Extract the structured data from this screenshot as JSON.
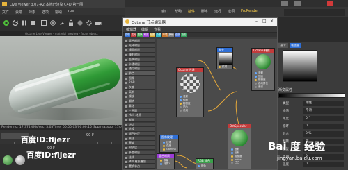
{
  "viewer": {
    "title": "Live Viewer 3.07-R2 本地已渲染 C4D 第一图",
    "menu": [
      "文件",
      "云端",
      "对象",
      "选项",
      "帮助",
      "Gui"
    ],
    "info_text": "Octane Live Viewer - material preview - focus object",
    "status": {
      "rendering": "Rendering: 17.374%",
      "ms": "Ms/sec: 3.03",
      "time": "Time: 00:00:03/00:00:15",
      "spp": "Spp/maxspp: 174/"
    },
    "timeline_value": "90 F",
    "lower_value": "90 F"
  },
  "c4d_menu": [
    {
      "label": "窗口",
      "highlight": false
    },
    {
      "label": "帮助",
      "highlight": false
    },
    {
      "label": "插件",
      "highlight": true
    },
    {
      "label": "脚本",
      "highlight": false
    },
    {
      "label": "运行",
      "highlight": false
    },
    {
      "label": "选项",
      "highlight": false
    },
    {
      "label": "ProRender",
      "highlight": true
    }
  ],
  "node_window": {
    "title": "Octane 节点编辑器",
    "menu": [
      "编辑器",
      "编辑",
      "查看"
    ],
    "tabs": [
      {
        "label": "纹理",
        "color": "#2f6fd6"
      },
      {
        "label": "发光",
        "color": "#c23b3b"
      },
      {
        "label": "置换",
        "color": "#3aa04a"
      },
      {
        "label": "材质",
        "color": "#9b3bd6"
      },
      {
        "label": "贴图",
        "color": "#d6a82f"
      },
      {
        "label": "介质",
        "color": "#2fb8c8"
      },
      {
        "label": "环境",
        "color": "#c8782f"
      },
      {
        "label": "其他",
        "color": "#7b7b7b"
      },
      {
        "label": "全部",
        "color": "#3b6bd6"
      },
      {
        "label": "投影",
        "color": "#2fa05a"
      }
    ],
    "list": [
      "混合材质",
      "光泽材质",
      "镜面材质",
      "漫射材质",
      "金属材质",
      "卡通材质",
      "通用材质",
      "节点",
      "图像",
      "RGB",
      "灰度",
      "高斯",
      "噪波",
      "翻转",
      "雾化",
      "三平面",
      "Hair 材质",
      "渐变",
      "烘焙",
      "转换",
      "颜色校正",
      "乘法",
      "衰减",
      "材质层",
      "多重材质",
      "法线",
      "MIX 材质叠加",
      "置换节点"
    ],
    "nodes": {
      "gradient": {
        "title": "渐变",
        "pins": [
          "纹理"
        ]
      },
      "material": {
        "title": "Octane 材质",
        "pins": [
          "漫射",
          "镜面",
          "粗糙度",
          "各向异性",
          "索引",
          "凹凸",
          "法线",
          "置换",
          "透明度"
        ]
      },
      "glossy": {
        "title": "Octane 光泽",
        "pins": [
          "漫射",
          "镜面",
          "粗糙度",
          "凹凸",
          "法线"
        ]
      },
      "image": {
        "title": "图像纹理",
        "pins": [
          "纹理",
          "强度",
          "Gamma"
        ]
      },
      "specular": {
        "title": "OctSpecular",
        "pins": [
          "透射",
          "反射",
          "粗糙度",
          "Index",
          "凹凸",
          "法线",
          "透明",
          "薄层"
        ]
      },
      "rgb": {
        "title": "RGB 颜色",
        "pins": [
          "颜色"
        ]
      },
      "mix": {
        "title": "混合材质",
        "pins": [
          "数量",
          "材质1",
          "材质2"
        ]
      }
    }
  },
  "attr_panel": {
    "tab_a": "基本",
    "tab_b": "着色器",
    "section": "渐变属性",
    "rows": [
      {
        "label": "类型",
        "value": "线性"
      },
      {
        "label": "插值",
        "value": "平滑"
      },
      {
        "label": "角度",
        "value": "0 °"
      },
      {
        "label": "循环",
        "value": "0"
      },
      {
        "label": "混合",
        "value": "0 %"
      },
      {
        "label": "翻转",
        "value": "否"
      },
      {
        "label": "重复",
        "value": "0"
      },
      {
        "label": "周期",
        "value": "0"
      },
      {
        "label": "强度",
        "value": "0"
      }
    ]
  },
  "watermark": {
    "left": "百度ID:fljezr",
    "left2": "百度ID:fljezr",
    "right_logo": "Bai 度 经验",
    "right_url": "jingyan.baidu.com"
  }
}
